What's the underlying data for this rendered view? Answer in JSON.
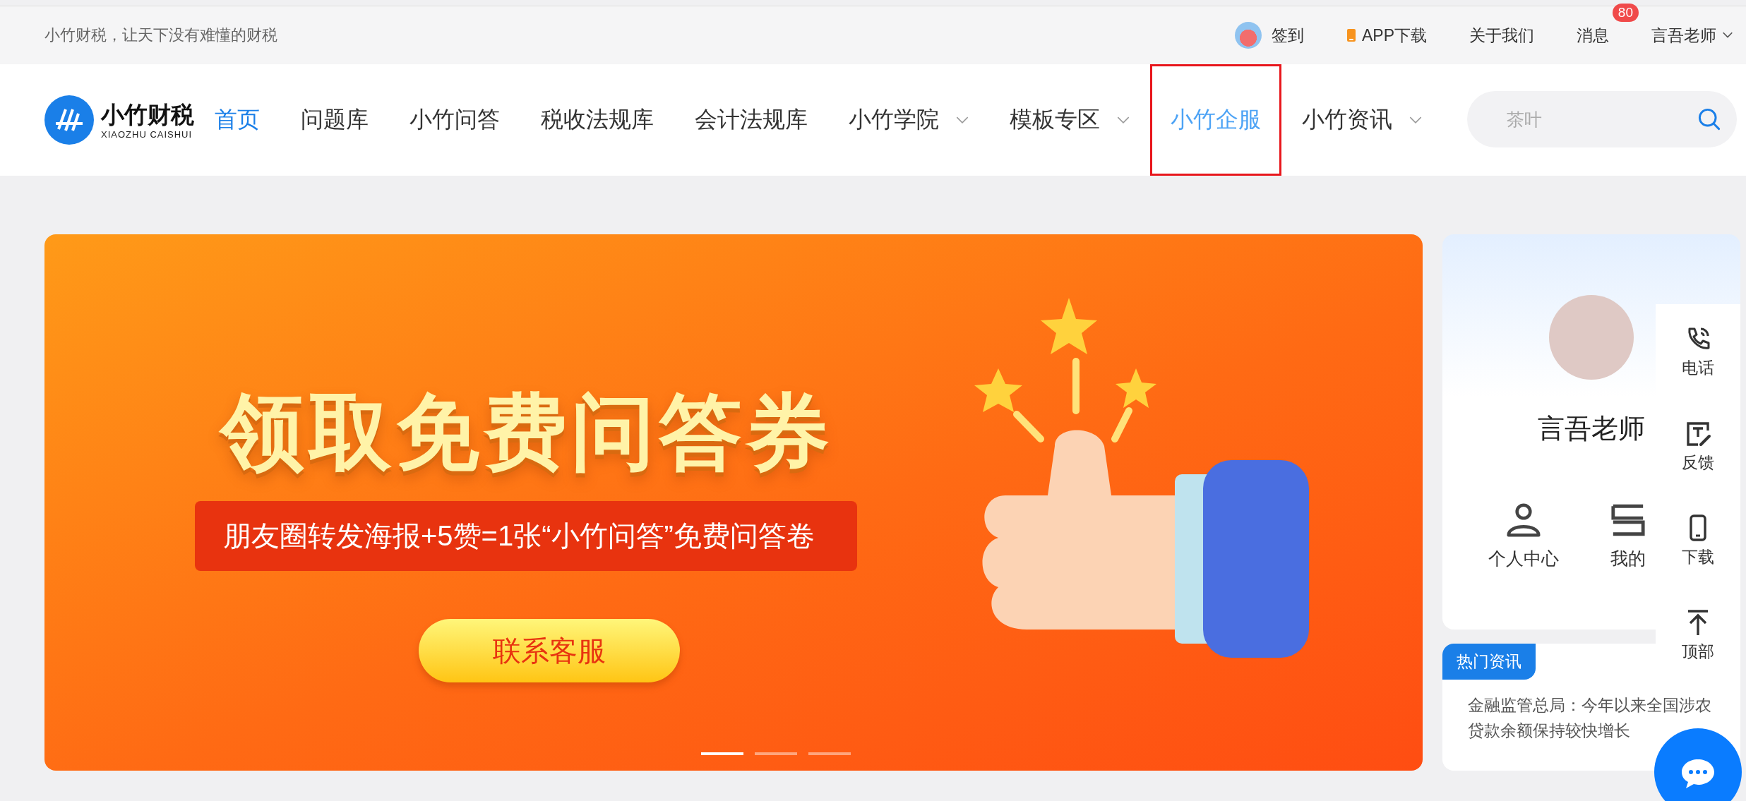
{
  "top_bar": {
    "slogan": "小竹财税，让天下没有难懂的财税",
    "links": [
      {
        "kind": "checkin",
        "label": "签到"
      },
      {
        "kind": "app",
        "label": "APP下载"
      },
      {
        "kind": "plain",
        "label": "关于我们"
      },
      {
        "kind": "messages",
        "label": "消息",
        "badge": "80"
      },
      {
        "kind": "user",
        "label": "言吾老师"
      }
    ]
  },
  "nav": {
    "logo": {
      "name": "小竹财税",
      "subtitle": "XIAOZHU CAISHUI"
    },
    "items": [
      {
        "label": "首页",
        "selected": true,
        "highlighted": false,
        "dropdown": false
      },
      {
        "label": "问题库",
        "selected": false,
        "highlighted": false,
        "dropdown": false
      },
      {
        "label": "小竹问答",
        "selected": false,
        "highlighted": false,
        "dropdown": false
      },
      {
        "label": "税收法规库",
        "selected": false,
        "highlighted": false,
        "dropdown": false
      },
      {
        "label": "会计法规库",
        "selected": false,
        "highlighted": false,
        "dropdown": false
      },
      {
        "label": "小竹学院",
        "selected": false,
        "highlighted": false,
        "dropdown": true
      },
      {
        "label": "模板专区",
        "selected": false,
        "highlighted": false,
        "dropdown": true
      },
      {
        "label": "小竹企服",
        "selected": false,
        "highlighted": true,
        "dropdown": false
      },
      {
        "label": "小竹资讯",
        "selected": false,
        "highlighted": false,
        "dropdown": true
      }
    ],
    "search": {
      "placeholder": "茶叶"
    }
  },
  "banner": {
    "title": "领取免费问答券",
    "subtitle": "朋友圈转发海报+5赞=1张“小竹问答”免费问答卷",
    "button": "联系客服",
    "indicators": [
      {
        "selected": true
      },
      {
        "selected": false
      },
      {
        "selected": false
      }
    ]
  },
  "profile_card": {
    "name": "言吾老师",
    "shortcuts": [
      {
        "kind": "person",
        "label": "个人中心"
      },
      {
        "kind": "list",
        "label": "我的"
      }
    ]
  },
  "news": {
    "tag": "热门资讯",
    "headline": "金融监管总局：今年以来全国涉农贷款余额保持较快增长"
  },
  "side_toolbar": [
    {
      "kind": "phone",
      "label": "电话"
    },
    {
      "kind": "feedback",
      "label": "反馈"
    },
    {
      "kind": "download",
      "label": "下载"
    },
    {
      "kind": "top",
      "label": "顶部"
    }
  ]
}
